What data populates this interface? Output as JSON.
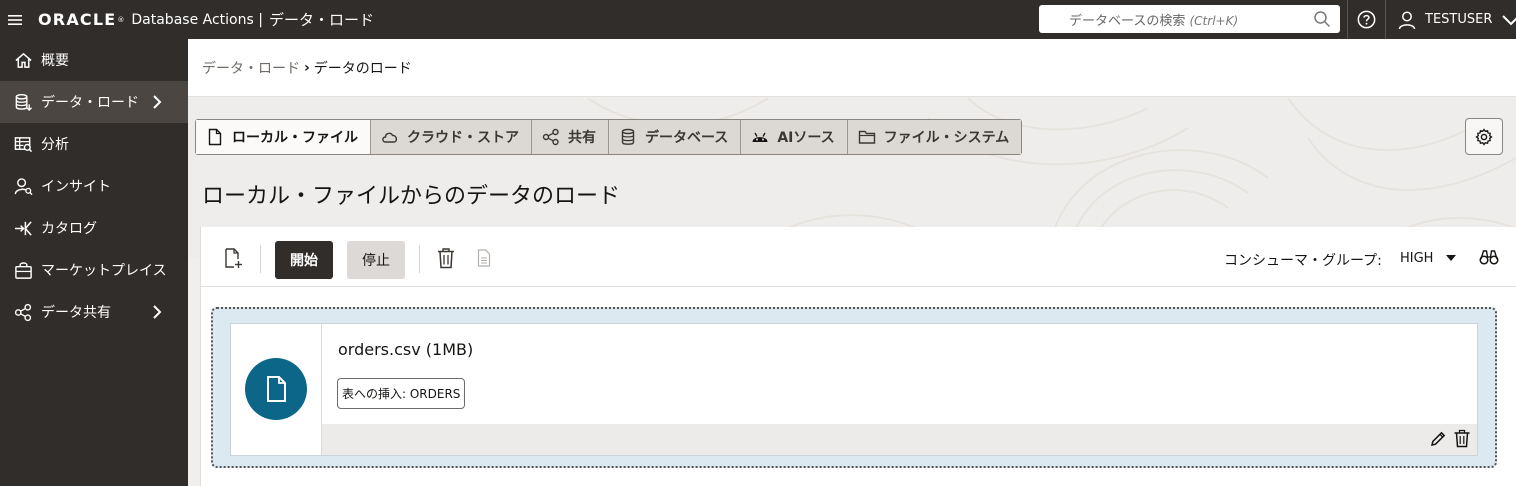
{
  "header": {
    "brand": "ORACLE",
    "app_name": "Database Actions |",
    "page_name": "データ・ロード",
    "search_placeholder": "データベースの検索",
    "search_shortcut": "(Ctrl+K)",
    "user_name": "TESTUSER"
  },
  "sidebar": {
    "items": [
      {
        "label": "概要",
        "icon": "home-icon"
      },
      {
        "label": "データ・ロード",
        "icon": "database-load-icon",
        "active": true,
        "has_submenu": true
      },
      {
        "label": "分析",
        "icon": "analysis-icon"
      },
      {
        "label": "インサイト",
        "icon": "insights-icon"
      },
      {
        "label": "カタログ",
        "icon": "catalog-icon"
      },
      {
        "label": "マーケットプレイス",
        "icon": "marketplace-icon"
      },
      {
        "label": "データ共有",
        "icon": "share-icon",
        "has_submenu": true
      }
    ]
  },
  "breadcrumb": {
    "parent": "データ・ロード",
    "separator": "›",
    "current": "データのロード"
  },
  "tabs": [
    {
      "label": "ローカル・ファイル",
      "icon": "file-icon",
      "selected": true
    },
    {
      "label": "クラウド・ストア",
      "icon": "cloud-icon"
    },
    {
      "label": "共有",
      "icon": "share-icon"
    },
    {
      "label": "データベース",
      "icon": "database-icon"
    },
    {
      "label": "AIソース",
      "icon": "android-icon"
    },
    {
      "label": "ファイル・システム",
      "icon": "folder-icon"
    }
  ],
  "page_title": "ローカル・ファイルからのデータのロード",
  "toolbar": {
    "start_label": "開始",
    "stop_label": "停止",
    "consumer_group_label": "コンシューマ・グループ:",
    "consumer_group_value": "HIGH"
  },
  "file_card": {
    "file_name": "orders.csv (1MB)",
    "badge": "表への挿入: ORDERS"
  },
  "colors": {
    "header_bg": "#312d2a",
    "accent_teal": "#0b6687",
    "dropzone_bg": "#dde9f1"
  }
}
